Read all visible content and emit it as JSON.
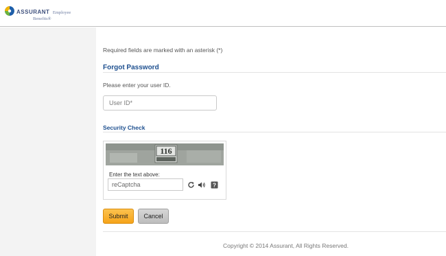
{
  "header": {
    "brand": "ASSURANT",
    "brand_suffix": "Employee",
    "brand_suffix2": "Benefits®",
    "logo_icon": "assurant-globe-logo"
  },
  "form": {
    "required_note": "Required fields are marked with an asterisk (*)",
    "title": "Forgot Password",
    "prompt": "Please enter your user ID.",
    "userid_placeholder": "User ID*",
    "userid_value": ""
  },
  "security": {
    "title": "Security Check",
    "captcha_label": "Enter the text above:",
    "captcha_placeholder": "reCaptcha",
    "captcha_value": "",
    "captcha_image_text": "116",
    "icons": [
      "refresh-icon",
      "audio-icon",
      "help-icon"
    ]
  },
  "buttons": {
    "submit": "Submit",
    "cancel": "Cancel"
  },
  "footer": {
    "copyright": "Copyright © 2014 Assurant, All Rights Reserved."
  },
  "colors": {
    "title_blue": "#1d4f8f",
    "submit_orange": "#f6a41a",
    "cancel_gray": "#bdbdbd",
    "left_pane": "#f3f3f3"
  }
}
